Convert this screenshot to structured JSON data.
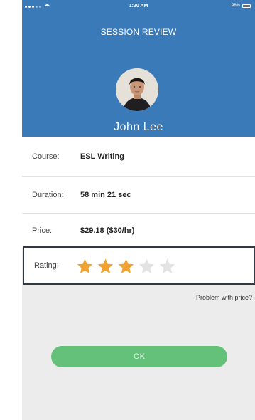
{
  "status_bar": {
    "carrier": "",
    "time": "1:20 AM",
    "battery": "98%"
  },
  "header": {
    "title": "SESSION REVIEW",
    "user_name": "John  Lee"
  },
  "details": {
    "course_label": "Course:",
    "course_value": "ESL Writing",
    "duration_label": "Duration:",
    "duration_value": "58 min 21 sec",
    "price_label": "Price:",
    "price_value": "$29.18  ($30/hr)"
  },
  "rating": {
    "label": "Rating:",
    "value": 3,
    "max": 5,
    "filled_color": "#f0a330",
    "empty_color": "#e3e3e3"
  },
  "problem_link": "Problem with price?",
  "ok_button": "OK",
  "colors": {
    "header_bg": "#3b7ab8",
    "ok_bg": "#63c17a",
    "page_bg": "#ececec"
  }
}
